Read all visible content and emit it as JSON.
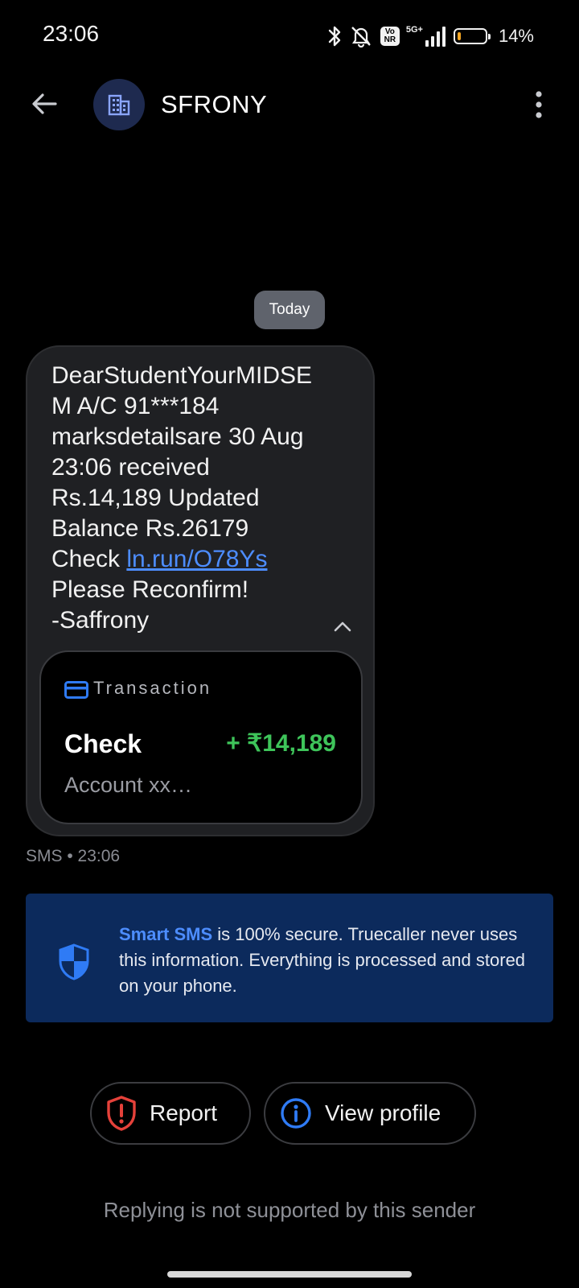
{
  "status_bar": {
    "time": "23:06",
    "icons": [
      "bluetooth-icon",
      "mute-icon",
      "vonr-icon",
      "5g-signal-icon",
      "battery-icon"
    ],
    "vonr_label": "Vo NR",
    "network_label": "5G+",
    "battery_percent": "14%",
    "battery_level": 0.14,
    "battery_color": "#f5a623"
  },
  "header": {
    "sender_name": "SFRONY",
    "avatar_icon": "building-icon",
    "avatar_bg": "#1e2a4f"
  },
  "conversation": {
    "date_chip": "Today",
    "message": {
      "line1": "DearStudentYourMIDSE",
      "line2": "M A/C 91***184",
      "line3": "marksdetailsare 30 Aug",
      "line4": "23:06 received",
      "line5": "Rs.14,189 Updated",
      "line6": "Balance Rs.26179",
      "line7_prefix": "Check ",
      "link": "ln.run/O78Ys",
      "line8": "Please Reconfirm!",
      "line9": "-Saffrony"
    },
    "transaction": {
      "type_label": "Transaction",
      "title": "Check",
      "amount": "+ ₹14,189",
      "account": "Account xx…",
      "amount_color": "#3ec45a"
    },
    "meta": "SMS • 23:06"
  },
  "info_banner": {
    "highlight": "Smart SMS",
    "text": " is 100% secure. Truecaller never uses this information. Everything is processed and stored on your phone.",
    "accent": "#4d8dff",
    "bg": "#0c2a5c"
  },
  "actions": {
    "report_label": "Report",
    "view_profile_label": "View profile",
    "report_color": "#e5413a",
    "profile_color": "#2f7bf5"
  },
  "reply_note": "Replying is not supported by this sender"
}
